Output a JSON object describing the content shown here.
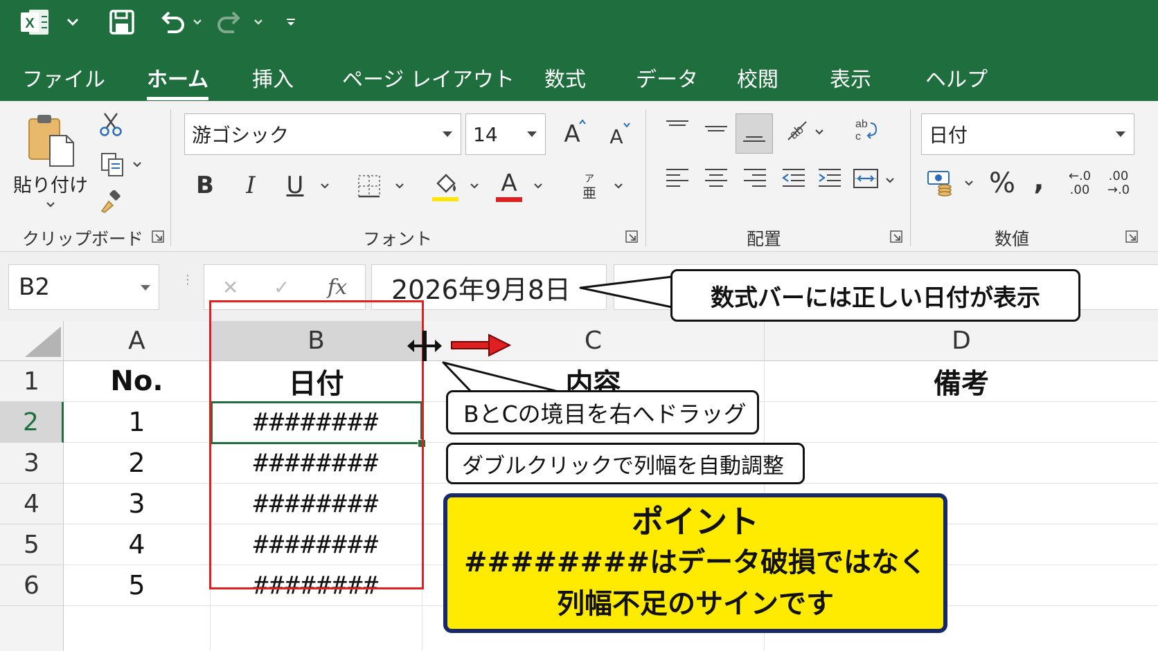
{
  "titlebar": {
    "app_icon": "excel-logo-icon",
    "save_icon": "save-icon",
    "undo_icon": "undo-icon",
    "redo_icon": "redo-icon",
    "customize_icon": "customize-quick-access-icon"
  },
  "menu": {
    "tabs": [
      {
        "label": "ファイル"
      },
      {
        "label": "ホーム",
        "active": true
      },
      {
        "label": "挿入"
      },
      {
        "label": "ページ レイアウト"
      },
      {
        "label": "数式"
      },
      {
        "label": "データ"
      },
      {
        "label": "校閲"
      },
      {
        "label": "表示"
      },
      {
        "label": "ヘルプ"
      }
    ]
  },
  "ribbon": {
    "clipboard": {
      "label": "クリップボード",
      "paste_label": "貼り付け"
    },
    "font": {
      "label": "フォント",
      "font_name": "游ゴシック",
      "font_size": "14",
      "bold": "B",
      "italic": "I",
      "underline": "U",
      "font_color_letter": "A",
      "grow_letter": "A",
      "shrink_letter": "A",
      "phonetic_top": "ア",
      "phonetic_bottom": "亜"
    },
    "alignment": {
      "label": "配置"
    },
    "number": {
      "label": "数値",
      "format": "日付",
      "percent": "%",
      "comma": ",",
      "inc_decimal_top": "←.0",
      "inc_decimal_bottom": ".00",
      "dec_decimal_top": ".00",
      "dec_decimal_bottom": "→.0"
    }
  },
  "formula_bar": {
    "name_box": "B2",
    "cancel": "✕",
    "enter": "✓",
    "fx": "fx",
    "value": "2026年9月8日"
  },
  "sheet": {
    "columns": [
      "A",
      "B",
      "C",
      "D"
    ],
    "rows": [
      {
        "num": "1",
        "a": "No.",
        "b": "日付",
        "c": "内容",
        "d": "備考"
      },
      {
        "num": "2",
        "a": "1",
        "b": "########",
        "c": "",
        "d": ""
      },
      {
        "num": "3",
        "a": "2",
        "b": "########",
        "c": "",
        "d": ""
      },
      {
        "num": "4",
        "a": "3",
        "b": "########",
        "c": "",
        "d": ""
      },
      {
        "num": "5",
        "a": "4",
        "b": "########",
        "c": "",
        "d": ""
      },
      {
        "num": "6",
        "a": "5",
        "b": "########",
        "c": "",
        "d": ""
      }
    ]
  },
  "annotations": {
    "formula_note": "数式バーには正しい日付が表示",
    "drag_note": "BとCの境目を右へドラッグ",
    "dblclick_note": "ダブルクリックで列幅を自動調整",
    "point_title": "ポイント",
    "point_line1": "########はデータ破損ではなく",
    "point_line2": "列幅不足のサインです"
  },
  "colors": {
    "excel_green": "#1e6e3e",
    "highlight_red": "#e02020",
    "point_yellow": "#ffeb00",
    "point_border": "#15296b"
  }
}
